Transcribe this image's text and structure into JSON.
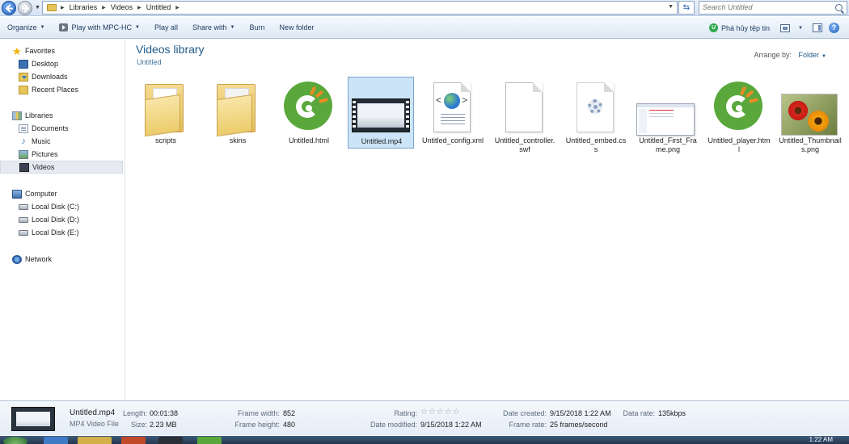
{
  "address": {
    "crumbs": [
      "Libraries",
      "Videos",
      "Untitled"
    ],
    "search_placeholder": "Search Untitled"
  },
  "toolbar": {
    "organize": "Organize",
    "play_with": "Play with MPC-HC",
    "play_all": "Play all",
    "share_with": "Share with",
    "burn": "Burn",
    "new_folder": "New folder",
    "uninstall": "Phá hủy tệp tin"
  },
  "nav": {
    "favorites": "Favorites",
    "desktop": "Desktop",
    "downloads": "Downloads",
    "recent_places": "Recent Places",
    "libraries": "Libraries",
    "documents": "Documents",
    "music": "Music",
    "pictures": "Pictures",
    "videos": "Videos",
    "computer": "Computer",
    "disk_c": "Local Disk (C:)",
    "disk_d": "Local Disk (D:)",
    "disk_e": "Local Disk (E:)",
    "network": "Network"
  },
  "content": {
    "title": "Videos library",
    "subtitle": "Untitled",
    "arrange_label": "Arrange by:",
    "arrange_value": "Folder",
    "files": [
      {
        "name": "scripts",
        "icon": "folder-icon"
      },
      {
        "name": "skins",
        "icon": "folder-icon"
      },
      {
        "name": "Untitled.html",
        "icon": "green-c-logo-icon"
      },
      {
        "name": "Untitled.mp4",
        "icon": "video-thumbnail-icon"
      },
      {
        "name": "Untitled_config.xml",
        "icon": "xml-document-icon"
      },
      {
        "name": "Untitled_controller.swf",
        "icon": "blank-document-icon"
      },
      {
        "name": "Untitled_embed.css",
        "icon": "css-document-icon"
      },
      {
        "name": "Untitled_First_Frame.png",
        "icon": "screenshot-thumbnail-icon"
      },
      {
        "name": "Untitled_player.html",
        "icon": "green-c-logo-icon"
      },
      {
        "name": "Untitled_Thumbnails.png",
        "icon": "flowers-thumbnail-icon"
      }
    ]
  },
  "details": {
    "filename": "Untitled.mp4",
    "filetype": "MP4 Video File",
    "length_label": "Length:",
    "length": "00:01:38",
    "size_label": "Size:",
    "size": "2.23 MB",
    "frame_width_label": "Frame width:",
    "frame_width": "852",
    "frame_height_label": "Frame height:",
    "frame_height": "480",
    "rating_label": "Rating:",
    "rating_stars": "☆☆☆☆☆",
    "date_modified_label": "Date modified:",
    "date_modified": "9/15/2018 1:22 AM",
    "date_created_label": "Date created:",
    "date_created": "9/15/2018 1:22 AM",
    "frame_rate_label": "Frame rate:",
    "frame_rate": "25 frames/second",
    "data_rate_label": "Data rate:",
    "data_rate": "135kbps"
  },
  "taskbar": {
    "clock": "1:22 AM"
  },
  "colors": {
    "accent_title": "#1e5a8a",
    "selection": "#cce4f7",
    "logo_green": "#5aa83c",
    "logo_orange": "#f08a24"
  }
}
